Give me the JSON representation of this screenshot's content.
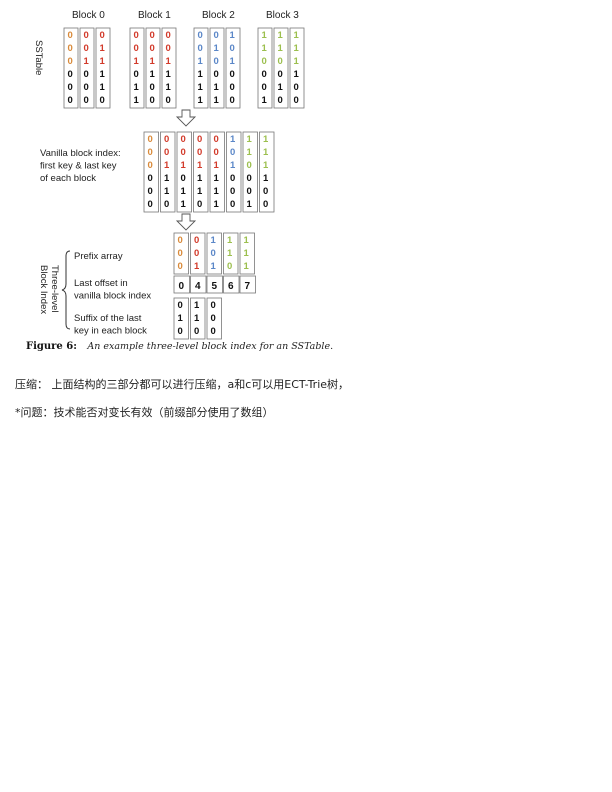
{
  "figure": {
    "block_headers": [
      "Block 0",
      "Block 1",
      "Block 2",
      "Block 3"
    ],
    "sstable_label": "SSTable",
    "sstable_blocks": [
      [
        [
          "0",
          "0",
          "0",
          "0",
          "0",
          "0"
        ],
        [
          "0",
          "0",
          "1",
          "0",
          "0",
          "0"
        ],
        [
          "0",
          "1",
          "1",
          "1",
          "1",
          "0"
        ]
      ],
      [
        [
          "0",
          "0",
          "1",
          "0",
          "1",
          "1"
        ],
        [
          "0",
          "0",
          "1",
          "1",
          "0",
          "0"
        ],
        [
          "0",
          "0",
          "1",
          "1",
          "1",
          "0"
        ]
      ],
      [
        [
          "0",
          "0",
          "1",
          "1",
          "1",
          "1"
        ],
        [
          "0",
          "1",
          "0",
          "0",
          "1",
          "1"
        ],
        [
          "1",
          "0",
          "1",
          "0",
          "0",
          "0"
        ]
      ],
      [
        [
          "1",
          "1",
          "0",
          "0",
          "0",
          "1"
        ],
        [
          "1",
          "1",
          "0",
          "0",
          "1",
          "0"
        ],
        [
          "1",
          "1",
          "1",
          "1",
          "0",
          "0"
        ]
      ]
    ],
    "vanilla_label": [
      "Vanilla block index:",
      "first key & last key",
      "of each block"
    ],
    "vanilla_columns": [
      [
        "0",
        "0",
        "0",
        "0",
        "0",
        "0"
      ],
      [
        "0",
        "0",
        "1",
        "1",
        "1",
        "0"
      ],
      [
        "0",
        "0",
        "1",
        "0",
        "1",
        "1"
      ],
      [
        "0",
        "0",
        "1",
        "1",
        "1",
        "0"
      ],
      [
        "0",
        "0",
        "1",
        "1",
        "1",
        "1"
      ],
      [
        "1",
        "0",
        "1",
        "0",
        "0",
        "0"
      ],
      [
        "1",
        "1",
        "0",
        "0",
        "0",
        "1"
      ],
      [
        "1",
        "1",
        "1",
        "1",
        "0",
        "0"
      ]
    ],
    "three_level_label": "Three-level\nBlock Index",
    "prefix_label": "Prefix array",
    "prefix_columns": [
      [
        "0",
        "0",
        "0"
      ],
      [
        "0",
        "0",
        "1"
      ],
      [
        "1",
        "0",
        "1"
      ],
      [
        "1",
        "1",
        "0"
      ],
      [
        "1",
        "1",
        "1"
      ]
    ],
    "offset_label": [
      "Last offset in",
      "vanilla block index"
    ],
    "offsets": [
      "0",
      "4",
      "5",
      "6",
      "7"
    ],
    "suffix_label": [
      "Suffix of the last",
      "key in each block"
    ],
    "suffix_columns": [
      [
        "0",
        "1",
        "0"
      ],
      [
        "1",
        "1",
        "0"
      ],
      [
        "0",
        "0",
        "0"
      ]
    ],
    "caption_label": "Figure 6:",
    "caption_text": "An example three-level block index for an SSTable."
  },
  "notes": {
    "line1": "压缩： 上面结构的三部分都可以进行压缩，a和c可以用ECT-Trie树，",
    "line2": "*问题：技术能否对变长有效（前缀部分使用了数组）"
  },
  "colors": {
    "orange": "#d98a3a",
    "red": "#d23a2a",
    "blue": "#5b87c8",
    "green": "#9cbf4e",
    "black": "#111111",
    "border": "#777777"
  }
}
